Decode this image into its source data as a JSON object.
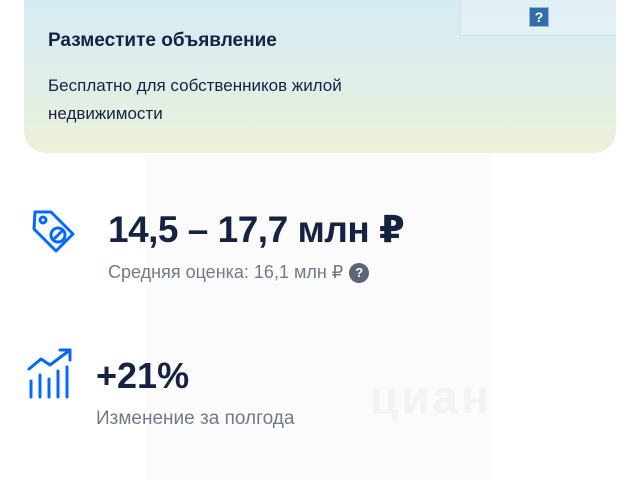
{
  "promo": {
    "title": "Разместите объявление",
    "text": "Бесплатно для собственников жилой недвижимости",
    "help_glyph": "?"
  },
  "watermark": {
    "logo_text": "циан"
  },
  "price": {
    "range": "14,5 – 17,7 млн ₽",
    "average": "Средняя оценка: 16,1 млн ₽",
    "help_icon": "?",
    "icon": "price-tag-icon"
  },
  "growth": {
    "value": "+21%",
    "label": "Изменение за полгода",
    "icon": "growth-chart-icon"
  },
  "colors": {
    "accent_blue": "#0468ff",
    "text_primary": "#152242",
    "text_secondary": "#707a89"
  }
}
